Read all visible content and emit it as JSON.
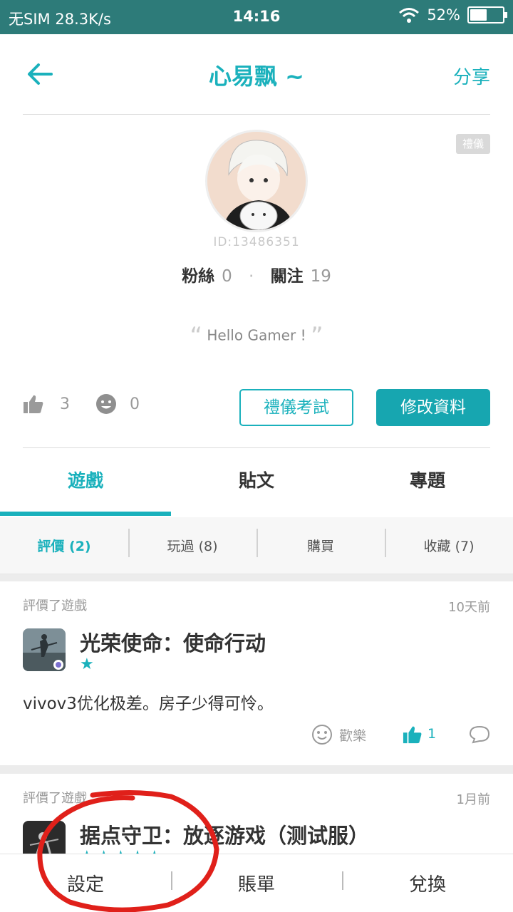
{
  "status": {
    "carrier": "无SIM",
    "speed": "28.3K/s",
    "time": "14:16",
    "battery": "52%",
    "battery_level": 0.52
  },
  "header": {
    "title": "心易飘 ~",
    "share": "分享"
  },
  "profile": {
    "badge": "禮儀",
    "uid": "ID:13486351",
    "fans_label": "粉絲",
    "fans": "0",
    "follow_label": "關注",
    "follow": "19",
    "quote": "Hello Gamer !",
    "likes": "3",
    "fun": "0",
    "etiquette_button": "禮儀考試",
    "edit_button": "修改資料"
  },
  "tabs": [
    "遊戲",
    "貼文",
    "專題"
  ],
  "subtabs": [
    {
      "label": "評價",
      "count": "(2)"
    },
    {
      "label": "玩過",
      "count": "(8)"
    },
    {
      "label": "購買",
      "count": ""
    },
    {
      "label": "收藏",
      "count": "(7)"
    }
  ],
  "reviews": [
    {
      "kind": "評價了遊戲",
      "when": "10天前",
      "game": "光荣使命：使命行动",
      "stars": "★",
      "text": "vivov3优化极差。房子少得可怜。",
      "fun_label": "歡樂",
      "likes": "1"
    },
    {
      "kind": "評價了遊戲",
      "when": "1月前",
      "game": "据点守卫：放逐游戏（测试服）",
      "stars": "★★★★★"
    }
  ],
  "bottom": [
    "設定",
    "賬單",
    "兌換"
  ],
  "colors": {
    "accent": "#1ab1bc",
    "statusbar": "#2d7b79",
    "annotation": "#e0201a"
  }
}
